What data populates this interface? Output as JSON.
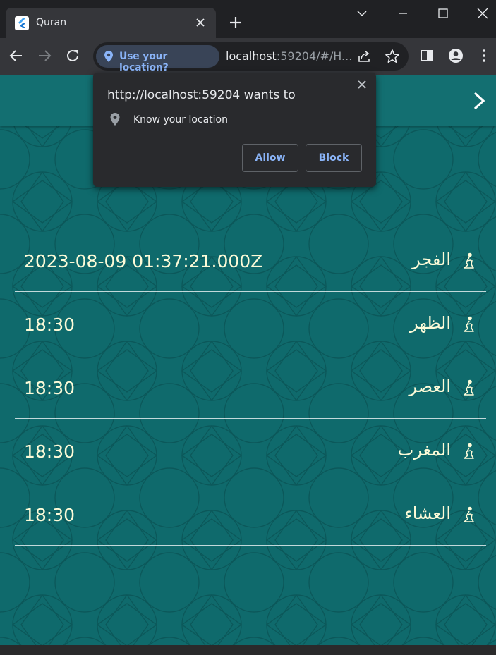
{
  "browser": {
    "tab_title": "Quran",
    "location_chip_label": "Use your location?",
    "url_host": "localhost",
    "url_rest": ":59204/#/H..."
  },
  "permission_popup": {
    "title": "http://localhost:59204 wants to",
    "permission": "Know your location",
    "allow_label": "Allow",
    "block_label": "Block"
  },
  "prayers": [
    {
      "name": "الفجر",
      "time": "2023-08-09 01:37:21.000Z"
    },
    {
      "name": "الظهر",
      "time": "18:30"
    },
    {
      "name": "العصر",
      "time": "18:30"
    },
    {
      "name": "المغرب",
      "time": "18:30"
    },
    {
      "name": "العشاء",
      "time": "18:30"
    }
  ],
  "colors": {
    "page_teal": "#0f6a6c",
    "text_cream": "#fdfbd8",
    "accent_blue": "#8ab4f8"
  },
  "icons": [
    "flutter-logo-icon",
    "close-icon",
    "plus-icon",
    "chevron-down-icon",
    "minimize-icon",
    "maximize-icon",
    "back-arrow-icon",
    "forward-arrow-icon",
    "reload-icon",
    "location-pin-icon",
    "share-icon",
    "star-icon",
    "side-panel-icon",
    "profile-icon",
    "more-vert-icon",
    "chevron-right-icon",
    "praying-person-icon"
  ]
}
